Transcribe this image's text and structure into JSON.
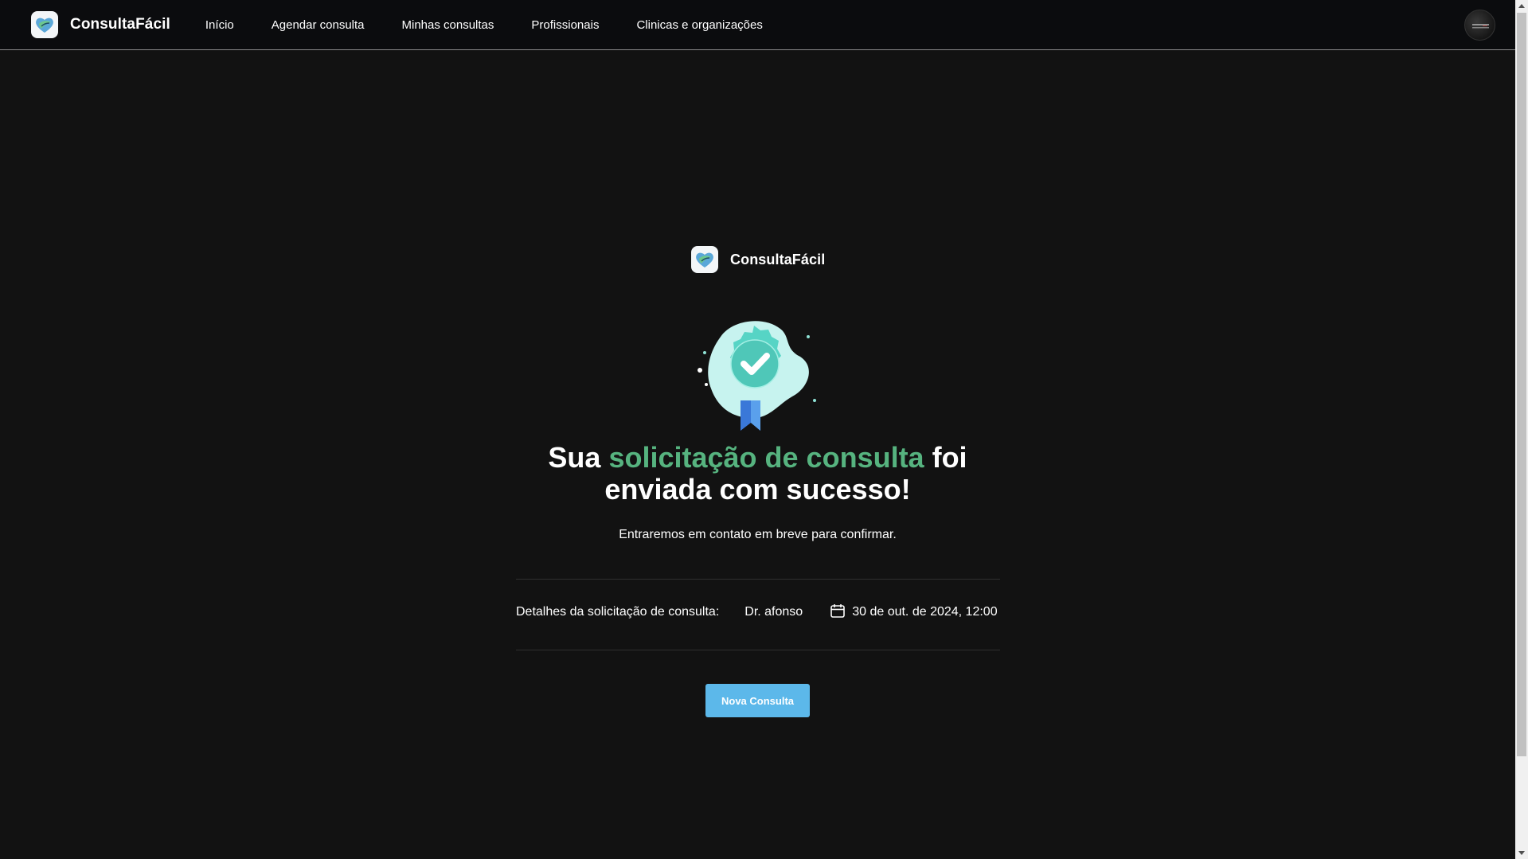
{
  "app": {
    "brand_name": "ConsultaFácil",
    "logo_icon": "heart-leaf-logo-icon"
  },
  "nav": {
    "items": [
      {
        "label": "Início"
      },
      {
        "label": "Agendar consulta"
      },
      {
        "label": "Minhas consultas"
      },
      {
        "label": "Profissionais"
      },
      {
        "label": "Clinicas e organizações"
      }
    ]
  },
  "user": {
    "avatar_icon": "user-avatar-icon"
  },
  "confirmation": {
    "brand_name": "ConsultaFácil",
    "badge_icon": "success-badge-check-icon",
    "headline_prefix": "Sua ",
    "headline_accent": "solicitação de consulta",
    "headline_suffix_1": " foi",
    "headline_line2": "enviada com sucesso!",
    "subtitle": "Entraremos em contato em breve para confirmar.",
    "details_label": "Detalhes da solicitação de consulta:",
    "doctor": "Dr. afonso",
    "calendar_icon": "calendar-icon",
    "datetime": "30 de out. de 2024, 12:00",
    "new_button": "Nova Consulta"
  },
  "colors": {
    "accent_green": "#56b37f",
    "button_blue": "#5cb8ea",
    "background": "#121212",
    "topbar": "#0b0c0e"
  }
}
